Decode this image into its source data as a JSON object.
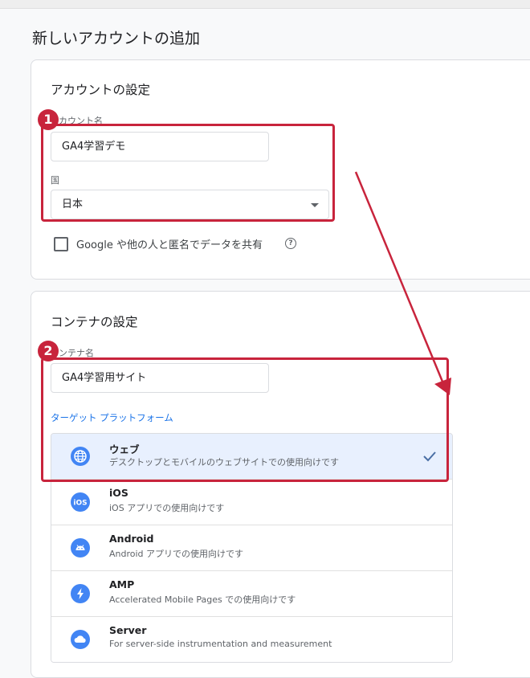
{
  "page": {
    "title": "新しいアカウントの追加"
  },
  "account": {
    "title": "アカウントの設定",
    "name_label": "カウント名",
    "name_value": "GA4学習デモ",
    "country_label": "国",
    "country_value": "日本",
    "share_label": "Google や他の人と匿名でデータを共有",
    "share_checked": false
  },
  "container": {
    "title": "コンテナの設定",
    "name_label": "ンテナ名",
    "name_value": "GA4学習用サイト",
    "platform_label": "ターゲット プラットフォーム",
    "platforms": [
      {
        "name": "ウェブ",
        "desc": "デスクトップとモバイルのウェブサイトでの使用向けです",
        "icon": "globe-icon",
        "selected": true
      },
      {
        "name": "iOS",
        "desc": "iOS アプリでの使用向けです",
        "icon": "ios-icon",
        "selected": false
      },
      {
        "name": "Android",
        "desc": "Android アプリでの使用向けです",
        "icon": "android-icon",
        "selected": false
      },
      {
        "name": "AMP",
        "desc": "Accelerated Mobile Pages での使用向けです",
        "icon": "bolt-icon",
        "selected": false
      },
      {
        "name": "Server",
        "desc": "For server-side instrumentation and measurement",
        "icon": "cloud-icon",
        "selected": false
      }
    ]
  },
  "annotations": {
    "badge1": "1",
    "badge2": "2"
  },
  "colors": {
    "annotation": "#c8243c",
    "accent": "#1a73e8",
    "icon_bg": "#4285f4",
    "selected_bg": "#e8f0fe"
  }
}
